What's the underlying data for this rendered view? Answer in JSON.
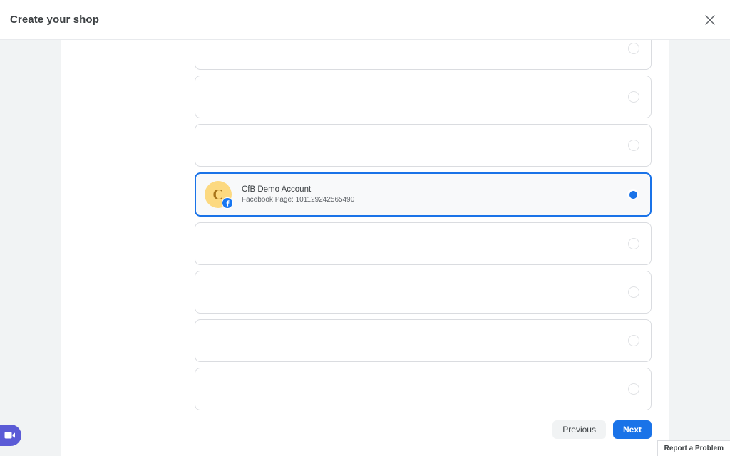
{
  "header": {
    "title": "Create your shop",
    "close_icon": "close-icon"
  },
  "main": {
    "accounts": [
      {
        "name": "",
        "subtitle": "",
        "selected": false,
        "avatar_letter": "",
        "partial": true
      },
      {
        "name": "",
        "subtitle": "",
        "selected": false,
        "avatar_letter": ""
      },
      {
        "name": "",
        "subtitle": "",
        "selected": false,
        "avatar_letter": ""
      },
      {
        "name": "CfB Demo Account",
        "subtitle": "Facebook Page: 101129242565490",
        "selected": true,
        "avatar_letter": "C",
        "badge": "facebook-icon"
      },
      {
        "name": "",
        "subtitle": "",
        "selected": false,
        "avatar_letter": ""
      },
      {
        "name": "",
        "subtitle": "",
        "selected": false,
        "avatar_letter": ""
      },
      {
        "name": "",
        "subtitle": "",
        "selected": false,
        "avatar_letter": ""
      },
      {
        "name": "",
        "subtitle": "",
        "selected": false,
        "avatar_letter": ""
      }
    ]
  },
  "footer": {
    "previous_label": "Previous",
    "next_label": "Next"
  },
  "overlays": {
    "report_problem_label": "Report a Problem",
    "chat_icon": "video-camera-icon"
  },
  "colors": {
    "accent_blue": "#1a73e8",
    "facebook_blue": "#1877f2",
    "avatar_bg": "#fcd980",
    "avatar_letter": "#a8741a",
    "chat_purple": "#5b5bd6",
    "card_border": "#dadce0",
    "gutter_gray": "#f1f3f4"
  }
}
